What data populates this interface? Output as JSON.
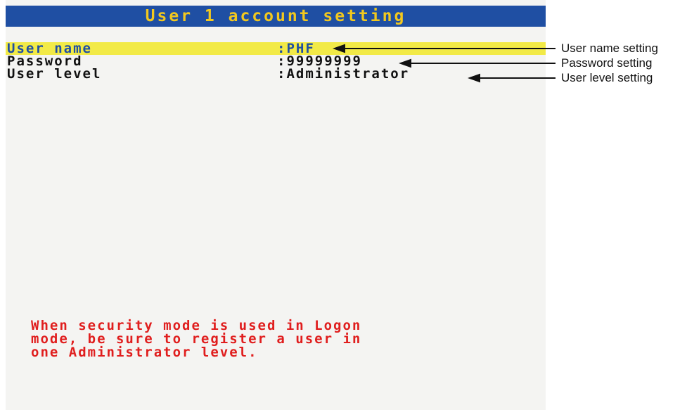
{
  "screen": {
    "title": "User 1 account setting",
    "rows": [
      {
        "label": "User name",
        "value": ":PHF",
        "selected": true
      },
      {
        "label": "Password",
        "value": ":99999999",
        "selected": false
      },
      {
        "label": "User level",
        "value": ":Administrator",
        "selected": false
      }
    ],
    "notice": [
      "When security mode is used in Logon",
      "mode, be sure to register a user in",
      "one Administrator level."
    ]
  },
  "callouts": [
    {
      "label": "User name setting"
    },
    {
      "label": "Password setting"
    },
    {
      "label": "User level setting"
    }
  ],
  "colors": {
    "title_bar_bg": "#1f4fa3",
    "title_text": "#f2c81e",
    "selected_row_bg": "#f2ea47",
    "selected_row_text": "#1f4fa3",
    "notice_text": "#e01e1e"
  }
}
